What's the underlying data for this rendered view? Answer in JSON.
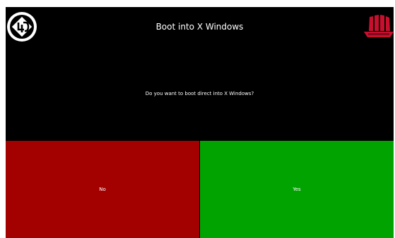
{
  "header": {
    "title": "Boot into X Windows",
    "left_logo_icon": "4d-systems-logo-icon",
    "right_logo_icon": "armadillo-ship-logo-icon"
  },
  "dialog": {
    "question": "Do you want to boot direct into X Windows?"
  },
  "buttons": {
    "no_label": "No",
    "yes_label": "Yes"
  },
  "colors": {
    "background": "#000000",
    "no_button": "#a30000",
    "yes_button": "#00a300",
    "text": "#ffffff",
    "logo_red": "#c8102e"
  }
}
